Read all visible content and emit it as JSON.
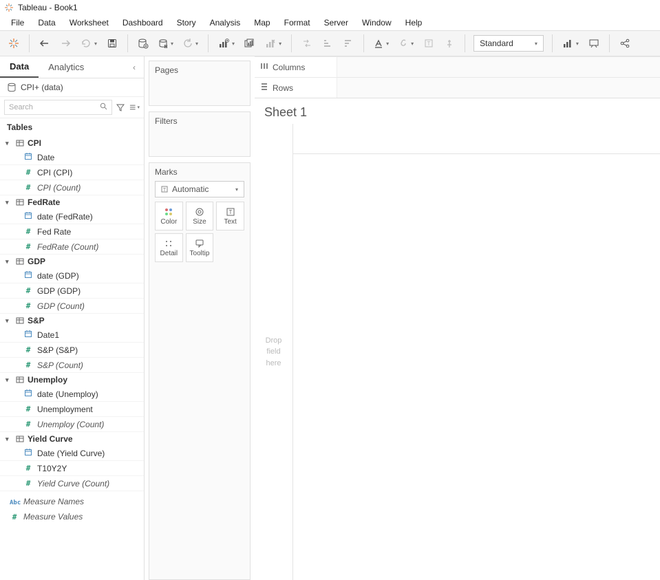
{
  "titlebar": {
    "title": "Tableau - Book1"
  },
  "menubar": [
    "File",
    "Data",
    "Worksheet",
    "Dashboard",
    "Story",
    "Analysis",
    "Map",
    "Format",
    "Server",
    "Window",
    "Help"
  ],
  "toolbar": {
    "fit_mode": "Standard"
  },
  "data_panel": {
    "tabs": {
      "data": "Data",
      "analytics": "Analytics"
    },
    "datasource": "CPI+ (data)",
    "search_placeholder": "Search",
    "tables_label": "Tables",
    "groups": [
      {
        "name": "CPI",
        "fields": [
          {
            "icon": "date",
            "label": "Date",
            "italic": false,
            "role": "dim"
          },
          {
            "icon": "num",
            "label": "CPI (CPI)",
            "italic": false,
            "role": "meas"
          },
          {
            "icon": "num",
            "label": "CPI (Count)",
            "italic": true,
            "role": "meas"
          }
        ]
      },
      {
        "name": "FedRate",
        "fields": [
          {
            "icon": "date",
            "label": "date (FedRate)",
            "italic": false,
            "role": "dim"
          },
          {
            "icon": "num",
            "label": "Fed Rate",
            "italic": false,
            "role": "meas"
          },
          {
            "icon": "num",
            "label": "FedRate (Count)",
            "italic": true,
            "role": "meas"
          }
        ]
      },
      {
        "name": "GDP",
        "fields": [
          {
            "icon": "date",
            "label": "date (GDP)",
            "italic": false,
            "role": "dim"
          },
          {
            "icon": "num",
            "label": "GDP (GDP)",
            "italic": false,
            "role": "meas"
          },
          {
            "icon": "num",
            "label": "GDP (Count)",
            "italic": true,
            "role": "meas"
          }
        ]
      },
      {
        "name": "S&P",
        "fields": [
          {
            "icon": "date",
            "label": "Date1",
            "italic": false,
            "role": "dim"
          },
          {
            "icon": "num",
            "label": "S&P (S&P)",
            "italic": false,
            "role": "meas"
          },
          {
            "icon": "num",
            "label": "S&P (Count)",
            "italic": true,
            "role": "meas"
          }
        ]
      },
      {
        "name": "Unemploy",
        "fields": [
          {
            "icon": "date",
            "label": "date (Unemploy)",
            "italic": false,
            "role": "dim"
          },
          {
            "icon": "num",
            "label": "Unemployment",
            "italic": false,
            "role": "meas"
          },
          {
            "icon": "num",
            "label": "Unemploy (Count)",
            "italic": true,
            "role": "meas"
          }
        ]
      },
      {
        "name": "Yield Curve",
        "fields": [
          {
            "icon": "date",
            "label": "Date (Yield Curve)",
            "italic": false,
            "role": "dim"
          },
          {
            "icon": "num",
            "label": "T10Y2Y",
            "italic": false,
            "role": "meas"
          },
          {
            "icon": "num",
            "label": "Yield Curve (Count)",
            "italic": true,
            "role": "meas"
          }
        ]
      }
    ],
    "extras": [
      {
        "icon": "abc",
        "label": "Measure Names",
        "italic": true,
        "role": "dim"
      },
      {
        "icon": "num",
        "label": "Measure Values",
        "italic": true,
        "role": "meas"
      }
    ]
  },
  "shelves": {
    "pages": "Pages",
    "filters": "Filters",
    "marks": "Marks",
    "marks_type": "Automatic",
    "mark_cards": [
      "Color",
      "Size",
      "Text",
      "Detail",
      "Tooltip"
    ]
  },
  "colrows": {
    "columns": "Columns",
    "rows": "Rows"
  },
  "sheet": {
    "title": "Sheet 1",
    "drop_hint": "Drop\nfield\nhere"
  }
}
